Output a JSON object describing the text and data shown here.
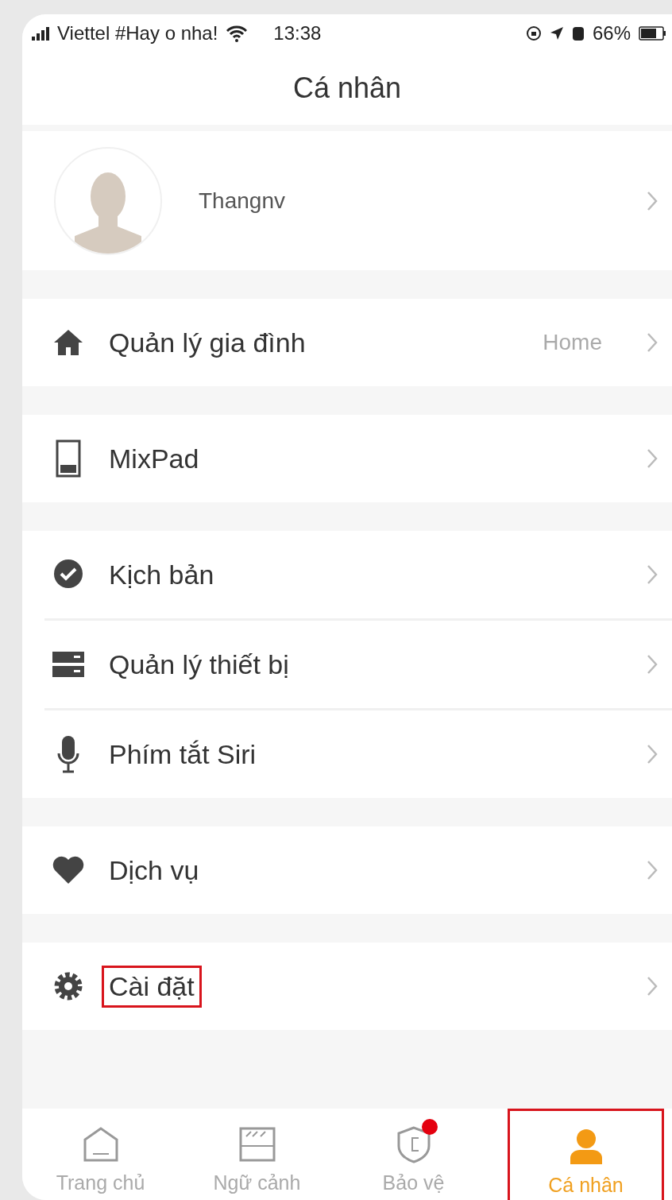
{
  "status_bar": {
    "carrier": "Viettel #Hay o nha!",
    "time": "13:38",
    "battery": "66%"
  },
  "header": {
    "title": "Cá nhân"
  },
  "profile": {
    "name": "Thangnv"
  },
  "groups": [
    {
      "items": [
        {
          "label": "Quản lý gia đình",
          "value": "Home",
          "highlighted": false
        }
      ]
    },
    {
      "items": [
        {
          "label": "MixPad",
          "highlighted": false
        }
      ]
    },
    {
      "items": [
        {
          "label": "Kịch bản",
          "highlighted": false
        },
        {
          "label": "Quản lý thiết bị",
          "highlighted": false
        },
        {
          "label": "Phím tắt Siri",
          "highlighted": false
        }
      ]
    },
    {
      "items": [
        {
          "label": "Dịch vụ",
          "highlighted": false
        }
      ]
    },
    {
      "items": [
        {
          "label": "Cài đặt",
          "highlighted": true
        }
      ]
    }
  ],
  "tabs": [
    {
      "label": "Trang chủ",
      "selected": false,
      "badge": false,
      "highlighted": false
    },
    {
      "label": "Ngữ cảnh",
      "selected": false,
      "badge": false,
      "highlighted": false
    },
    {
      "label": "Bảo vệ",
      "selected": false,
      "badge": true,
      "highlighted": false
    },
    {
      "label": "Cá nhân",
      "selected": true,
      "badge": false,
      "highlighted": true
    }
  ]
}
